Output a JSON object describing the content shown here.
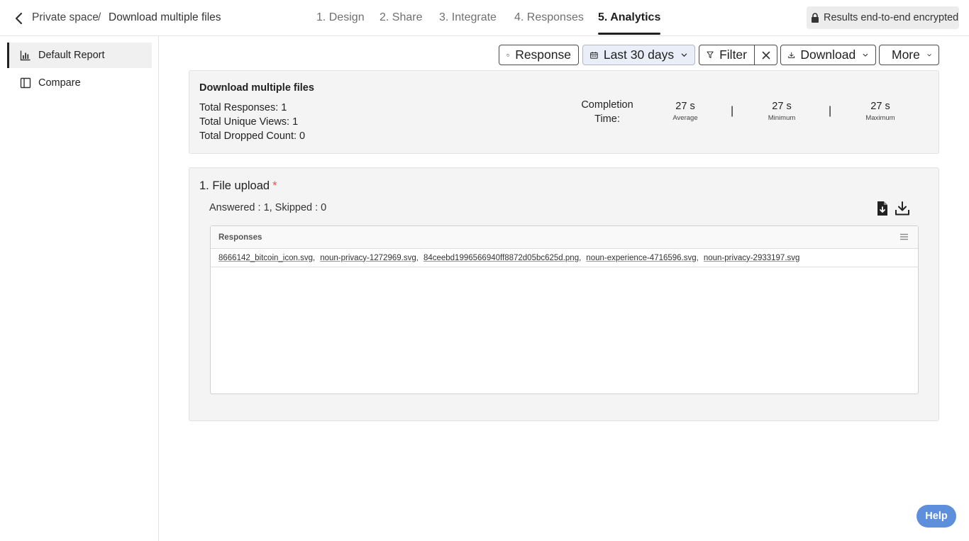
{
  "header": {
    "breadcrumb_space": "Private space",
    "breadcrumb_separator": "/",
    "breadcrumb_form": "Download multiple files",
    "steps": [
      {
        "label": "1. Design"
      },
      {
        "label": "2. Share"
      },
      {
        "label": "3. Integrate"
      },
      {
        "label": "4. Responses"
      },
      {
        "label": "5. Analytics",
        "active": true
      }
    ],
    "encrypted_label": "Results end-to-end encrypted"
  },
  "sidebar": {
    "items": [
      {
        "label": "Default Report",
        "icon": "bar-chart-icon",
        "active": true
      },
      {
        "label": "Compare",
        "icon": "book-icon"
      }
    ]
  },
  "toolbar": {
    "response_label": "Response",
    "date_range_label": "Last 30 days",
    "filter_label": "Filter",
    "download_label": "Download",
    "more_label": "More"
  },
  "summary": {
    "title": "Download multiple files",
    "total_responses": "Total Responses: 1",
    "total_unique_views": "Total Unique Views: 1",
    "total_dropped": "Total Dropped Count: 0",
    "completion_time_label": "Completion Time:",
    "metrics": [
      {
        "value": "27 s",
        "label": "Average"
      },
      {
        "value": "27 s",
        "label": "Minimum"
      },
      {
        "value": "27 s",
        "label": "Maximum"
      }
    ],
    "separator": "|"
  },
  "question": {
    "title": "1. File upload",
    "required_marker": "*",
    "stats": "Answered :  1, Skipped :  0",
    "table_header": "Responses",
    "files": [
      "8666142_bitcoin_icon.svg",
      "noun-privacy-1272969.svg",
      "84ceebd1996566940ff8872d05bc625d.png",
      "noun-experience-4716596.svg",
      "noun-privacy-2933197.svg"
    ]
  },
  "help_label": "Help",
  "colors": {
    "accent_help": "#5d8fdc",
    "required": "#e05a4a",
    "date_button_bg": "#e9eef8"
  }
}
